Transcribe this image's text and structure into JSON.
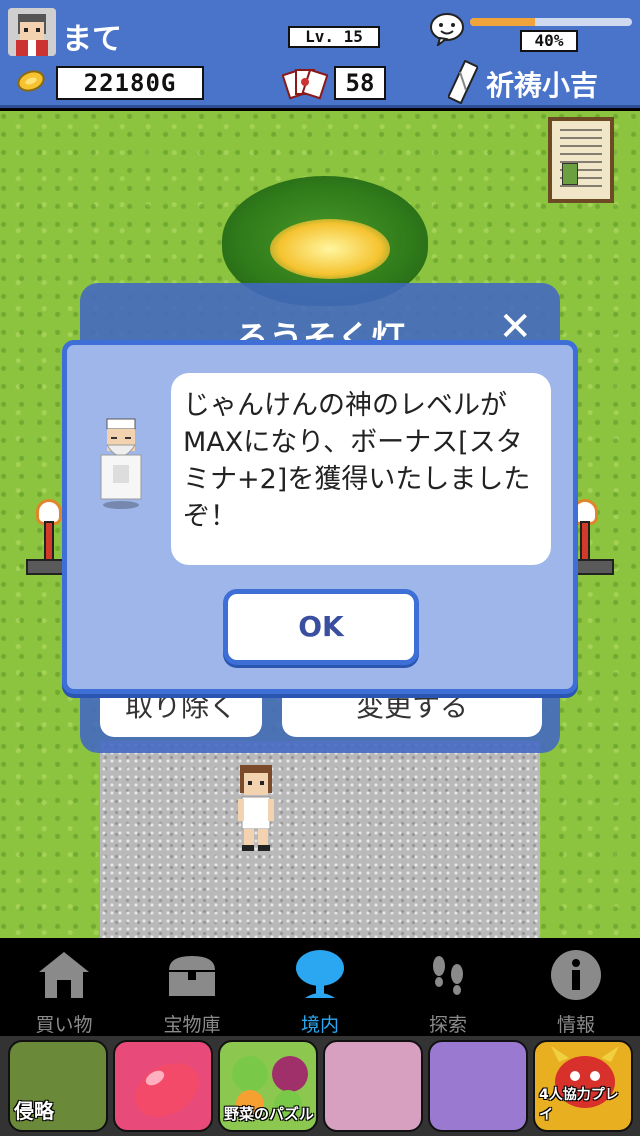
{
  "header": {
    "player_name": "まて",
    "level": "Lv. 15",
    "mood_percent_label": "40%",
    "mood_value": 0.4,
    "gold": "22180G",
    "cards": "58",
    "fortune": "祈祷小吉"
  },
  "candle_dialog": {
    "title": "ろうそく灯",
    "remove_label": "取り除く",
    "change_label": "変更する"
  },
  "message_modal": {
    "text": "じゃんけんの神のレベルがMAXになり、ボーナス[スタミナ+2]を獲得いたしましたぞ！",
    "ok_label": "OK"
  },
  "tabs": [
    {
      "label": "買い物",
      "icon": "shrine-icon",
      "active": false
    },
    {
      "label": "宝物庫",
      "icon": "treasure-chest-icon",
      "active": false
    },
    {
      "label": "境内",
      "icon": "sacred-tree-icon",
      "active": true
    },
    {
      "label": "探索",
      "icon": "footprints-icon",
      "active": false
    },
    {
      "label": "情報",
      "icon": "info-icon",
      "active": false
    }
  ],
  "ads": [
    {
      "label": "侵略",
      "color": "#6a8a3a"
    },
    {
      "label": "",
      "color": "#e84a7a"
    },
    {
      "label": "野菜のパズル",
      "color": "#8cc850"
    },
    {
      "label": "",
      "color": "#d8a0c0"
    },
    {
      "label": "",
      "color": "#9a7ad0"
    },
    {
      "label": "4人協力プレイ",
      "color": "#e8b020"
    }
  ],
  "colors": {
    "header_bg": "#4a74c9",
    "modal_border": "#3d6fd6",
    "active_tab": "#2aa7f0",
    "grass": "#8cc43f"
  }
}
